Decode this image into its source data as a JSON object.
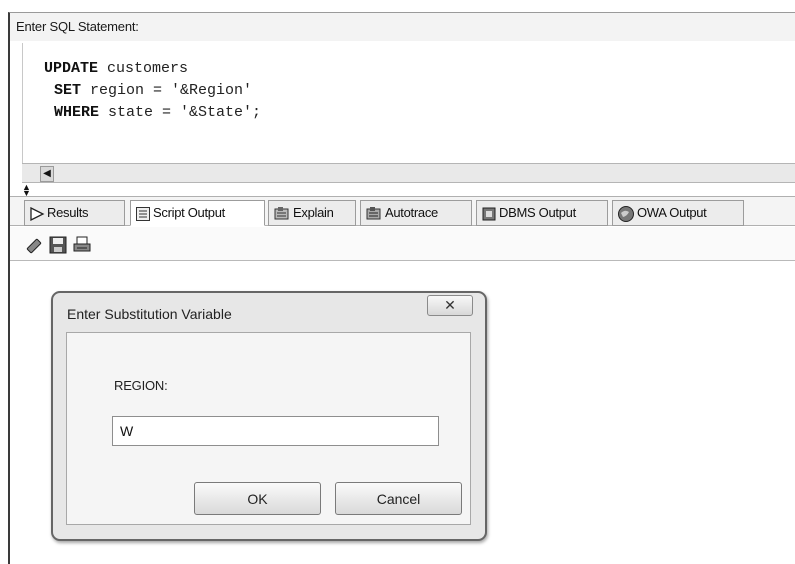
{
  "editor": {
    "header_label": "Enter SQL Statement:",
    "lines": [
      {
        "keyword": "UPDATE",
        "rest": " customers"
      },
      {
        "keyword": "SET",
        "rest": " region = '&Region'"
      },
      {
        "keyword": "WHERE",
        "rest": " state = '&State';"
      }
    ]
  },
  "tabs": [
    {
      "label": "Results",
      "icon": "play-arrow-icon"
    },
    {
      "label": "Script Output",
      "icon": "script-icon"
    },
    {
      "label": "Explain",
      "icon": "explain-plan-icon"
    },
    {
      "label": "Autotrace",
      "icon": "autotrace-icon"
    },
    {
      "label": "DBMS Output",
      "icon": "dbms-output-icon"
    },
    {
      "label": "OWA Output",
      "icon": "owa-globe-icon"
    }
  ],
  "active_tab": "Script Output",
  "toolbar": {
    "icons": [
      "eraser-icon",
      "save-disk-icon",
      "print-icon"
    ]
  },
  "dialog": {
    "title": "Enter Substitution Variable",
    "close_glyph": "✕",
    "field_label": "REGION:",
    "field_value": "W",
    "ok_label": "OK",
    "cancel_label": "Cancel"
  }
}
